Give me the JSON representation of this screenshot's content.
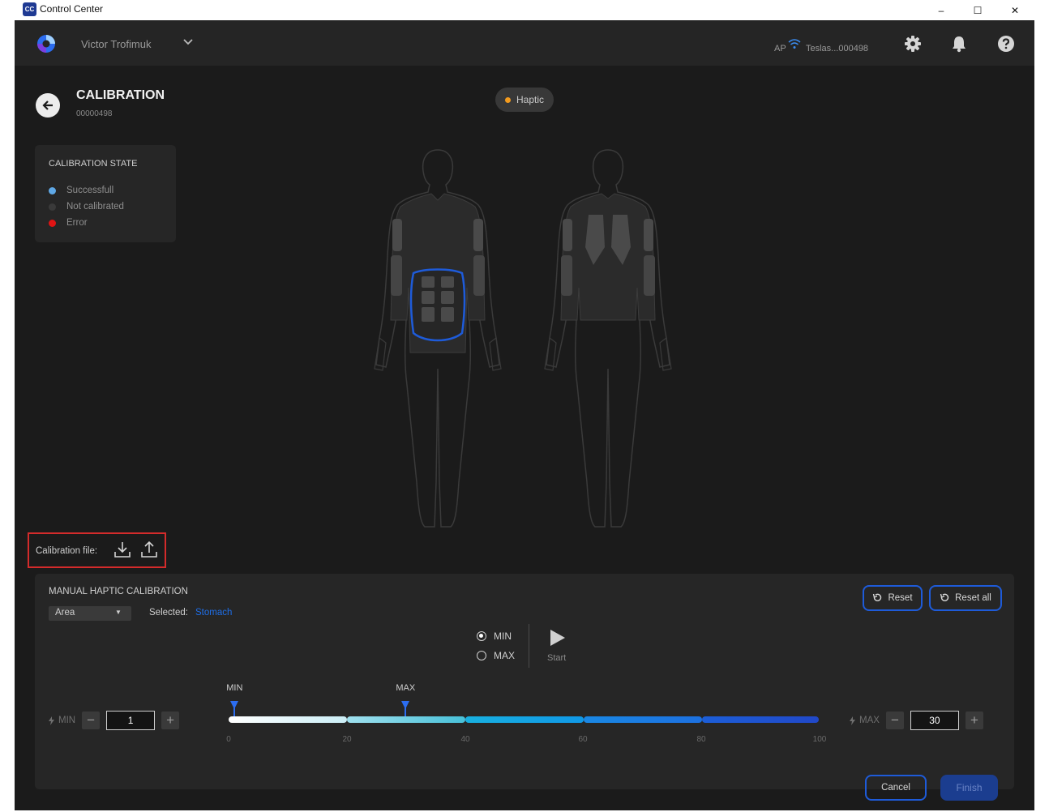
{
  "window": {
    "icon_text": "CC",
    "title": "Control Center",
    "minimize": "–",
    "maximize": "☐",
    "close": "✕"
  },
  "header": {
    "user_name": "Victor Trofimuk",
    "ap_label": "AP",
    "network_name": "Teslas...000498"
  },
  "page": {
    "title": "CALIBRATION",
    "device_id": "00000498",
    "mode_chip": "Haptic"
  },
  "calibration_state": {
    "title": "CALIBRATION STATE",
    "items": [
      {
        "label": "Successfull",
        "color": "#5fa8e6"
      },
      {
        "label": "Not calibrated",
        "color": "#3a3a3a"
      },
      {
        "label": "Error",
        "color": "#e01414"
      }
    ]
  },
  "calibration_file": {
    "label": "Calibration file:"
  },
  "manual": {
    "title": "MANUAL HAPTIC CALIBRATION",
    "area_select": "Area",
    "selected_label": "Selected:",
    "selected_value": "Stomach",
    "reset_label": "Reset",
    "reset_all_label": "Reset all",
    "radio_min": "MIN",
    "radio_max": "MAX",
    "radio_selected": "MIN",
    "start_label": "Start",
    "marker_min_label": "MIN",
    "marker_max_label": "MAX",
    "min_value_label": "MIN",
    "min_value": "1",
    "max_value_label": "MAX",
    "max_value": "30",
    "slider_min": 1,
    "slider_max": 30,
    "slider_range": [
      0,
      100
    ],
    "ticks": [
      "0",
      "20",
      "40",
      "60",
      "80",
      "100"
    ],
    "cancel_label": "Cancel",
    "finish_label": "Finish"
  },
  "colors": {
    "accent": "#1e5bd9",
    "selected_text": "#1e6ee8",
    "status_orange": "#f39b1e",
    "highlight_red": "#d42b2b"
  }
}
